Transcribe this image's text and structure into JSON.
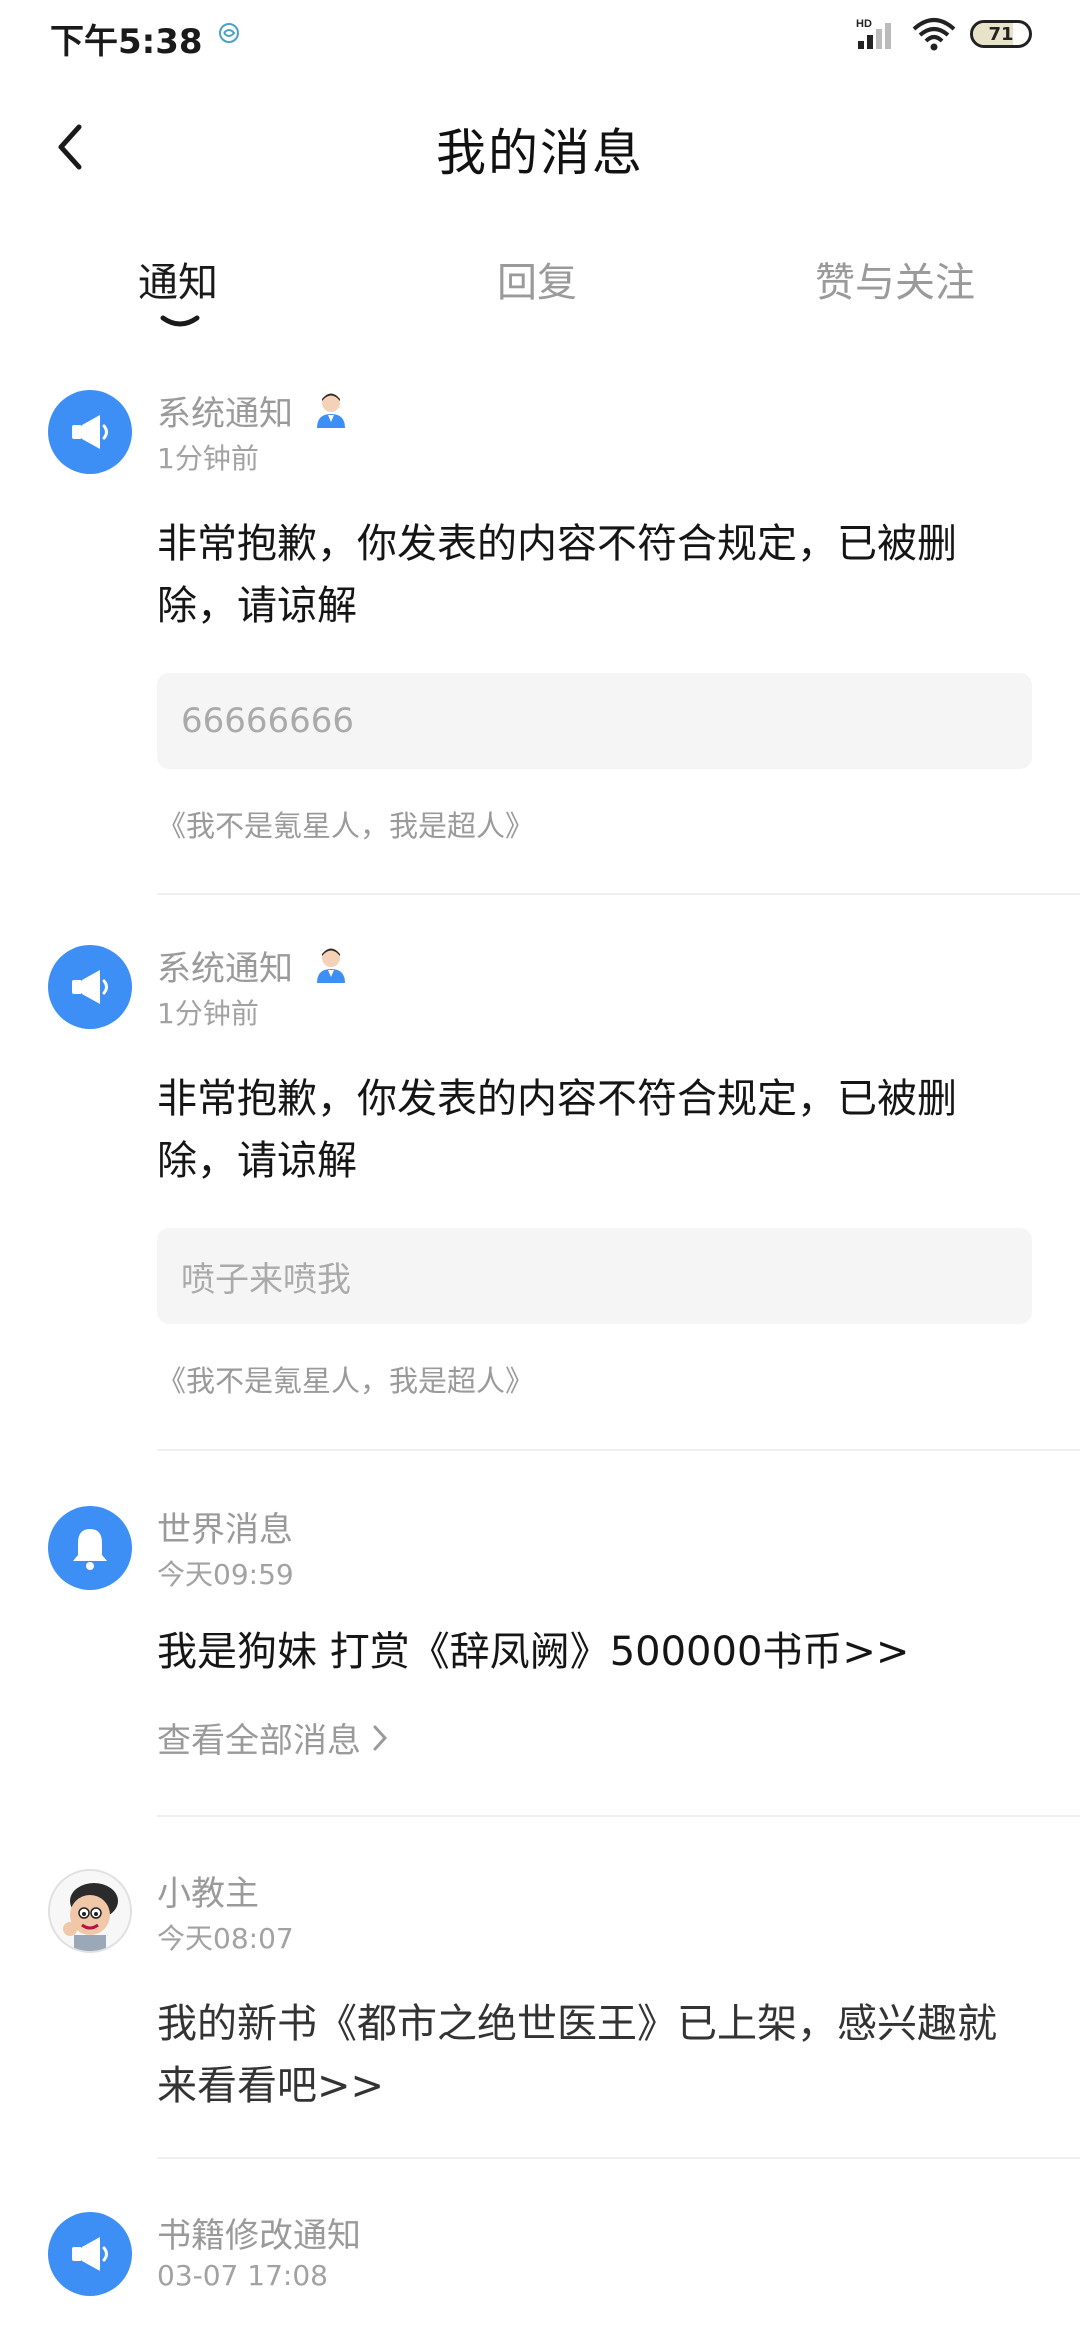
{
  "status_bar": {
    "time": "下午5:38",
    "network": "HD",
    "battery_level": 71,
    "battery_text": "71"
  },
  "header": {
    "back_icon": "chevron-left-icon",
    "title": "我的消息"
  },
  "tabs": [
    {
      "label": "通知",
      "active": true
    },
    {
      "label": "回复",
      "active": false
    },
    {
      "label": "赞与关注",
      "active": false
    }
  ],
  "colors": {
    "accent": "#3d8ff5",
    "text_primary": "#151515",
    "text_secondary": "#9a9a9a",
    "quote_bg": "#f5f5f5"
  },
  "messages": [
    {
      "icon": "megaphone-icon",
      "sender": "系统通知",
      "badge_icon": "official-person-icon",
      "time": "1分钟前",
      "body": "非常抱歉，你发表的内容不符合规定，已被删除，请谅解",
      "quote": "66666666",
      "book": "《我不是氪星人，我是超人》"
    },
    {
      "icon": "megaphone-icon",
      "sender": "系统通知",
      "badge_icon": "official-person-icon",
      "time": "1分钟前",
      "body": "非常抱歉，你发表的内容不符合规定，已被删除，请谅解",
      "quote": "喷子来喷我",
      "book": "《我不是氪星人，我是超人》"
    },
    {
      "icon": "bell-icon",
      "sender": "世界消息",
      "time": "今天09:59",
      "body": "我是狗妹 打赏《辞凤阙》500000书币>>",
      "link": "查看全部消息"
    },
    {
      "icon": "cartoon-avatar",
      "sender": "小教主",
      "time": "今天08:07",
      "body": "我的新书《都市之绝世医王》已上架，感兴趣就来看看吧>>"
    },
    {
      "icon": "megaphone-icon",
      "sender": "书籍修改通知",
      "time": "03-07 17:08"
    }
  ]
}
